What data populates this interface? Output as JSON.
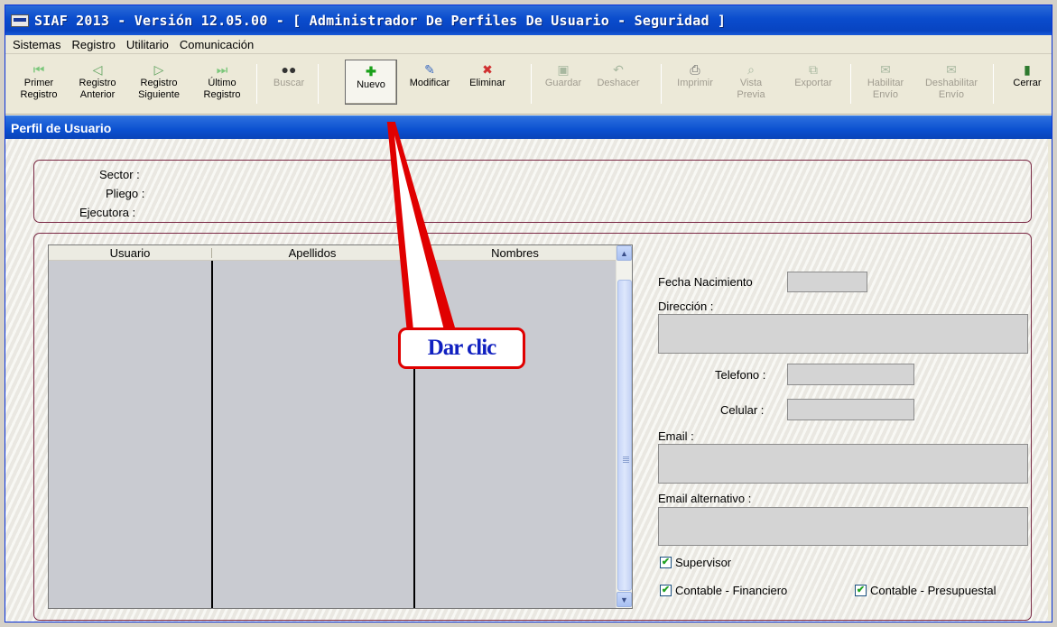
{
  "window": {
    "title": "SIAF 2013 - Versión 12.05.00 - [ Administrador De Perfiles De Usuario - Seguridad ]"
  },
  "menu": [
    "Sistemas",
    "Registro",
    "Utilitario",
    "Comunicación"
  ],
  "toolbar": {
    "primer": {
      "line1": "Primer",
      "line2": "Registro"
    },
    "anterior": {
      "line1": "Registro",
      "line2": "Anterior"
    },
    "siguiente": {
      "line1": "Registro",
      "line2": "Siguiente"
    },
    "ultimo": {
      "line1": "Último",
      "line2": "Registro"
    },
    "buscar": {
      "line1": "Buscar"
    },
    "nuevo": {
      "line1": "Nuevo"
    },
    "modificar": {
      "line1": "Modificar"
    },
    "eliminar": {
      "line1": "Eliminar"
    },
    "guardar": {
      "line1": "Guardar"
    },
    "deshacer": {
      "line1": "Deshacer"
    },
    "imprimir": {
      "line1": "Imprimir"
    },
    "vista": {
      "line1": "Vista",
      "line2": "Previa"
    },
    "exportar": {
      "line1": "Exportar"
    },
    "habilitar": {
      "line1": "Habilitar",
      "line2": "Envío"
    },
    "deshabilitar": {
      "line1": "Deshabilitar",
      "line2": "Envío"
    },
    "cerrar": {
      "line1": "Cerrar"
    }
  },
  "panel": {
    "title": "Perfil de Usuario"
  },
  "header_fields": {
    "sector": "Sector :",
    "pliego": "Pliego :",
    "ejecutora": "Ejecutora :"
  },
  "grid": {
    "columns": [
      "Usuario",
      "Apellidos",
      "Nombres"
    ]
  },
  "form": {
    "fecha_nacimiento": "Fecha Nacimiento",
    "direccion": "Dirección :",
    "telefono": "Telefono :",
    "celular": "Celular :",
    "email": "Email :",
    "email_alternativo": "Email  alternativo :",
    "supervisor": "Supervisor",
    "contable_financiero": "Contable - Financiero",
    "contable_presupuestal": "Contable - Presupuestal"
  },
  "annotation": {
    "text": "Dar clic",
    "color": "#e00000"
  }
}
